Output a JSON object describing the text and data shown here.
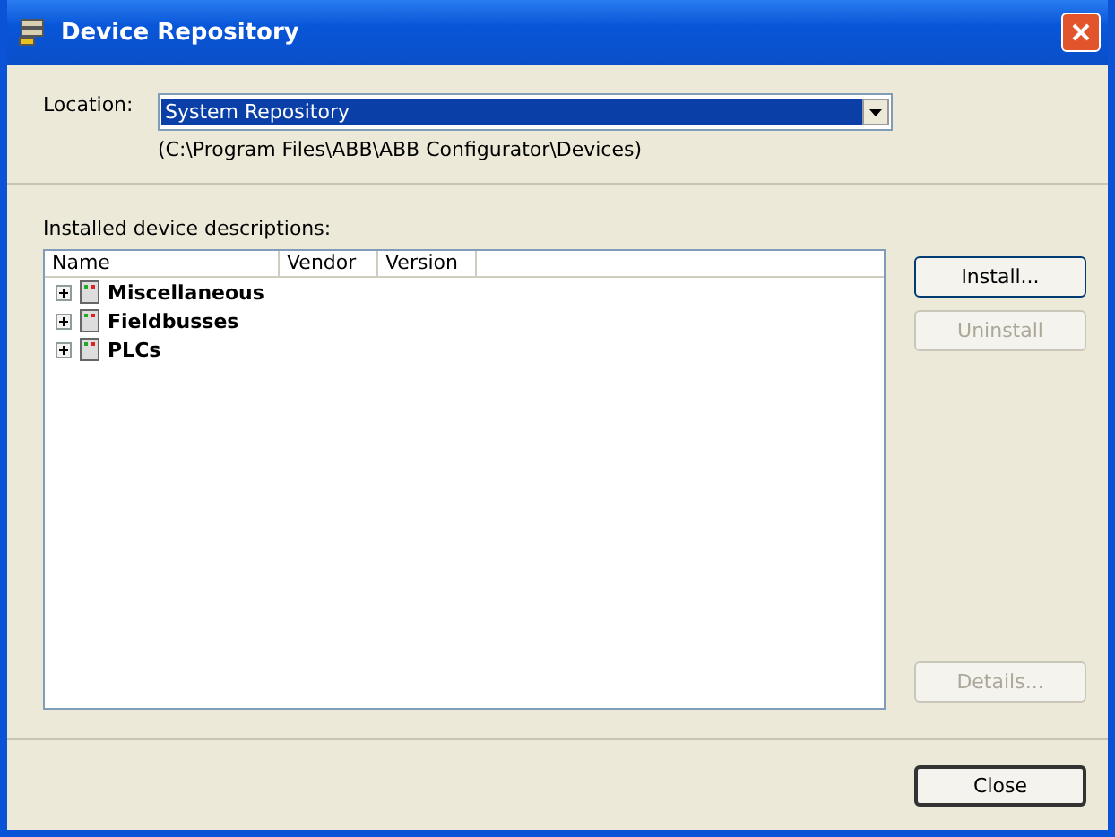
{
  "window": {
    "title": "Device Repository"
  },
  "location": {
    "label": "Location:",
    "value": "System Repository",
    "path": "(C:\\Program Files\\ABB\\ABB Configurator\\Devices)"
  },
  "list_label": "Installed device descriptions:",
  "table": {
    "columns": [
      "Name",
      "Vendor",
      "Version"
    ],
    "rows": [
      {
        "name": "Miscellaneous",
        "expanded": false
      },
      {
        "name": "Fieldbusses",
        "expanded": false
      },
      {
        "name": "PLCs",
        "expanded": false
      }
    ]
  },
  "side_buttons": [
    {
      "label": "Install...",
      "disabled": false
    },
    {
      "label": "Uninstall",
      "disabled": true
    }
  ],
  "details_button": {
    "label": "Details...",
    "disabled": true
  },
  "close_button": {
    "label": "Close"
  }
}
